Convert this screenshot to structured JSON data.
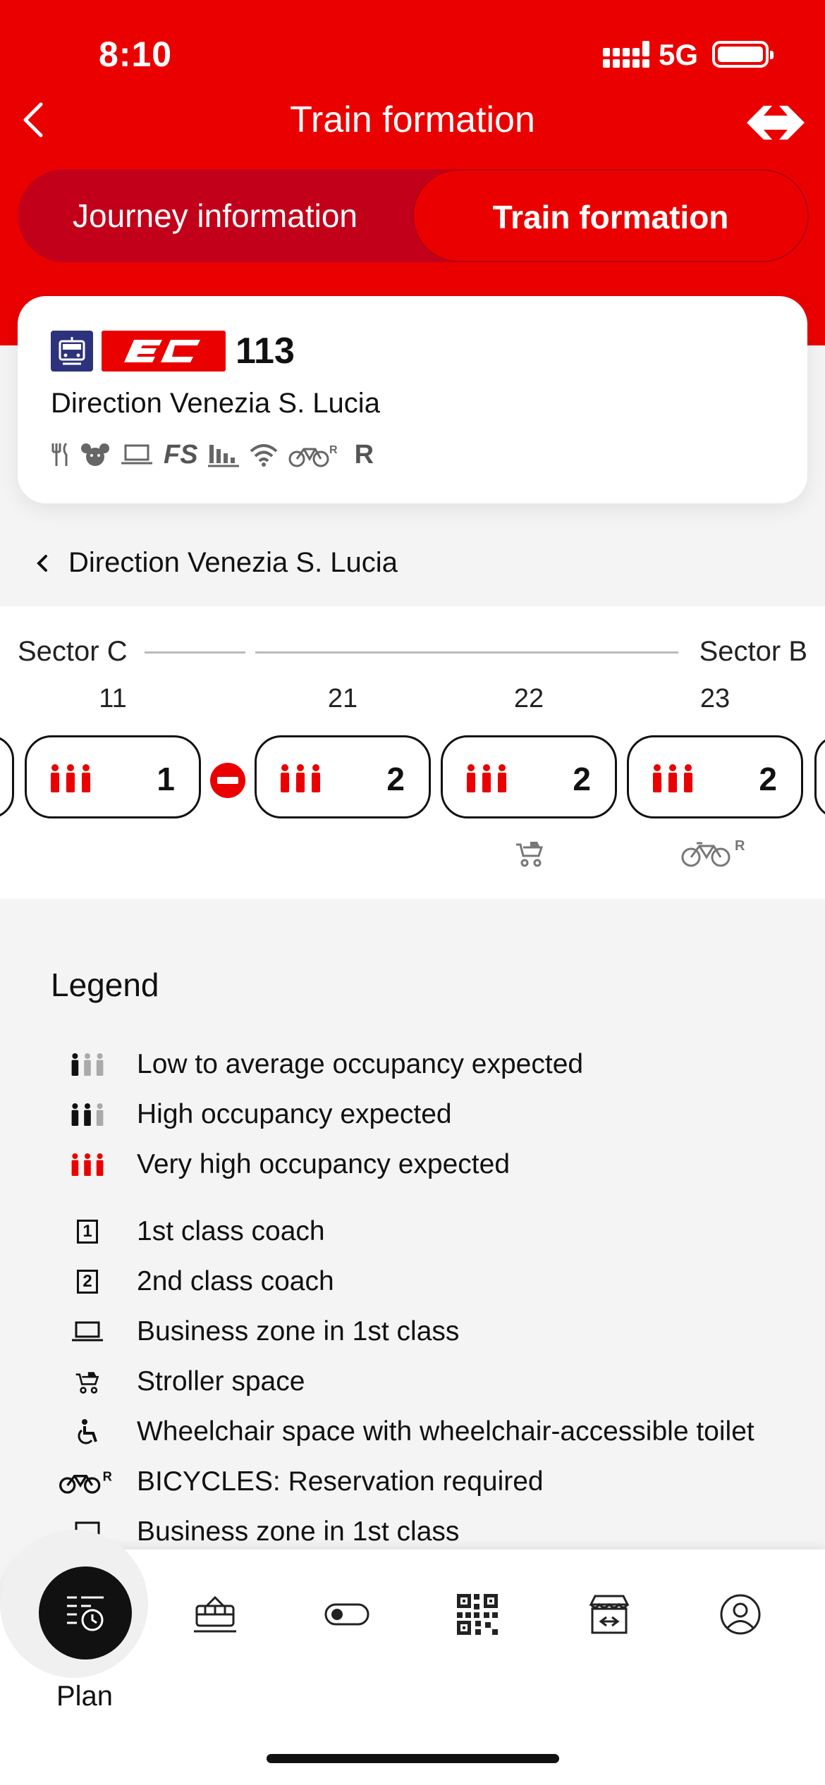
{
  "status": {
    "time": "8:10",
    "network": "5G"
  },
  "nav": {
    "title": "Train formation"
  },
  "segmented": {
    "journey_label": "Journey information",
    "formation_label": "Train formation"
  },
  "train": {
    "category": "EC",
    "number": "113",
    "direction": "Direction Venezia S. Lucia",
    "service_icons": [
      "restaurant-icon",
      "family-icon",
      "laptop-icon",
      "FS",
      "business-icon",
      "wifi-icon",
      "bicycle-reservation-icon",
      "R"
    ],
    "service_fs": "FS",
    "service_r": "R"
  },
  "direction_link": "Direction Venezia S. Lucia",
  "formation": {
    "sector_start": "Sector C",
    "sector_end": "Sector B",
    "coaches": [
      {
        "number": "11",
        "class": "1",
        "occupancy": "very-high",
        "extra": ""
      },
      {
        "number": "21",
        "class": "2",
        "occupancy": "very-high",
        "extra": ""
      },
      {
        "number": "22",
        "class": "2",
        "occupancy": "very-high",
        "extra": "stroller-icon"
      },
      {
        "number": "23",
        "class": "2",
        "occupancy": "very-high",
        "extra": "bicycle-reservation-icon"
      }
    ]
  },
  "legend": {
    "title": "Legend",
    "items": [
      {
        "icon": "occupancy-low-icon",
        "label": "Low to average occupancy expected"
      },
      {
        "icon": "occupancy-high-icon",
        "label": "High occupancy expected"
      },
      {
        "icon": "occupancy-very-high-icon",
        "label": "Very high occupancy expected"
      },
      {
        "icon": "first-class-icon",
        "label": "1st class coach",
        "glyph": "1"
      },
      {
        "icon": "second-class-icon",
        "label": "2nd class coach",
        "glyph": "2"
      },
      {
        "icon": "laptop-icon",
        "label": "Business zone in 1st class"
      },
      {
        "icon": "stroller-icon",
        "label": "Stroller space"
      },
      {
        "icon": "wheelchair-icon",
        "label": "Wheelchair space with wheelchair-accessible toilet"
      },
      {
        "icon": "bicycle-reservation-icon",
        "label": "BICYCLES: Reservation required"
      },
      {
        "icon": "laptop-icon",
        "label": "Business zone in 1st class"
      }
    ]
  },
  "tabbar": {
    "plan_label": "Plan",
    "tabs": [
      "plan-icon",
      "train-icon",
      "toggle-icon",
      "qr-code-icon",
      "shop-icon",
      "profile-icon"
    ]
  },
  "colors": {
    "brand_red": "#eb0000",
    "dark_red": "#c2001a",
    "navy": "#2d327d"
  }
}
